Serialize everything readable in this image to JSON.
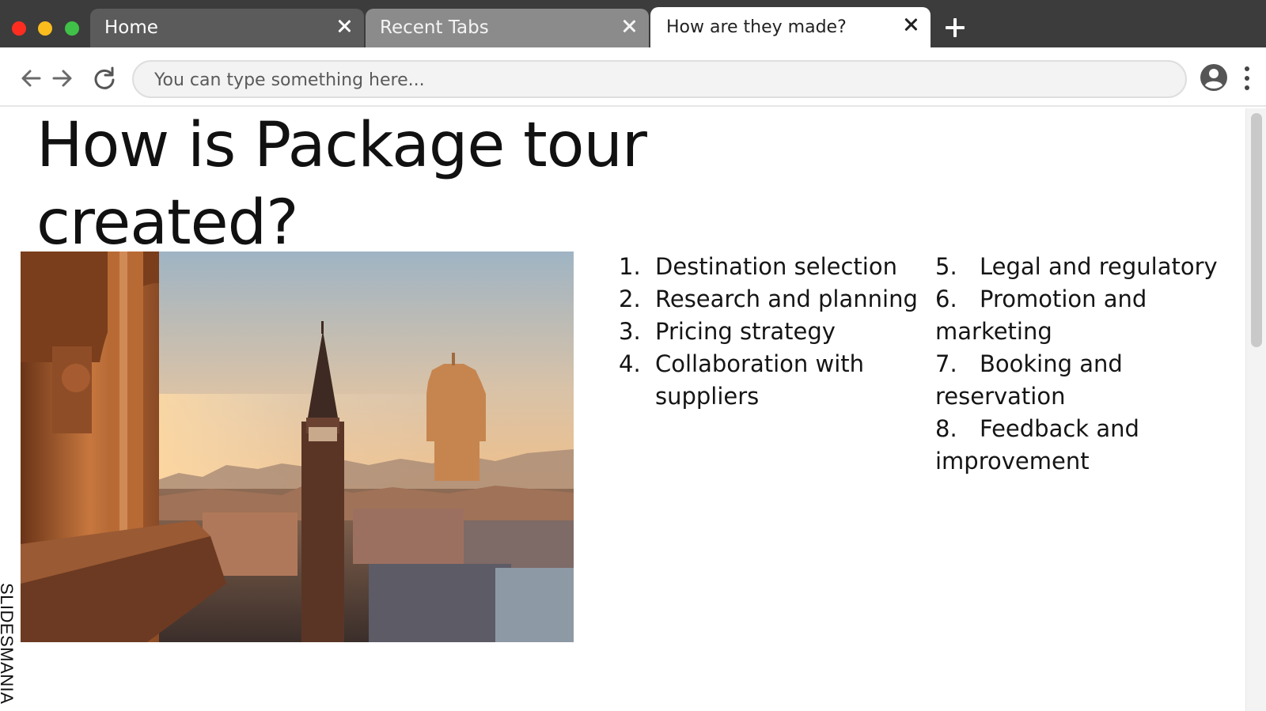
{
  "browser": {
    "tabs": [
      {
        "label": "Home",
        "active": false
      },
      {
        "label": "Recent Tabs",
        "active": false
      },
      {
        "label": "How are they made?",
        "active": true
      }
    ],
    "address_bar": {
      "placeholder": "You can type something here...",
      "value": ""
    }
  },
  "slide": {
    "title": "How is Package tour created?",
    "steps_left": [
      {
        "num": "1.",
        "text": "Destination selection"
      },
      {
        "num": "2.",
        "text": "Research and planning"
      },
      {
        "num": "3.",
        "text": "Pricing strategy"
      },
      {
        "num": "4.",
        "text": "Collaboration with suppliers"
      }
    ],
    "steps_right": [
      {
        "num": "5.",
        "text": "Legal and regulatory"
      },
      {
        "num": "6.",
        "text": "Promotion and marketing"
      },
      {
        "num": "7.",
        "text": "Booking and reservation"
      },
      {
        "num": "8.",
        "text": "Feedback and improvement"
      }
    ],
    "watermark": "SLIDESMANIA"
  },
  "colors": {
    "chrome_dark": "#3c3c3c",
    "tab_home": "#5b5b5b",
    "tab_recent": "#8b8b8b",
    "close_red": "#ff2d20",
    "minimize_yellow": "#fbbd1e",
    "maximize_green": "#3fc247"
  },
  "icons": [
    "back-arrow-icon",
    "forward-arrow-icon",
    "reload-icon",
    "profile-icon",
    "more-menu-icon",
    "close-icon",
    "plus-icon"
  ]
}
